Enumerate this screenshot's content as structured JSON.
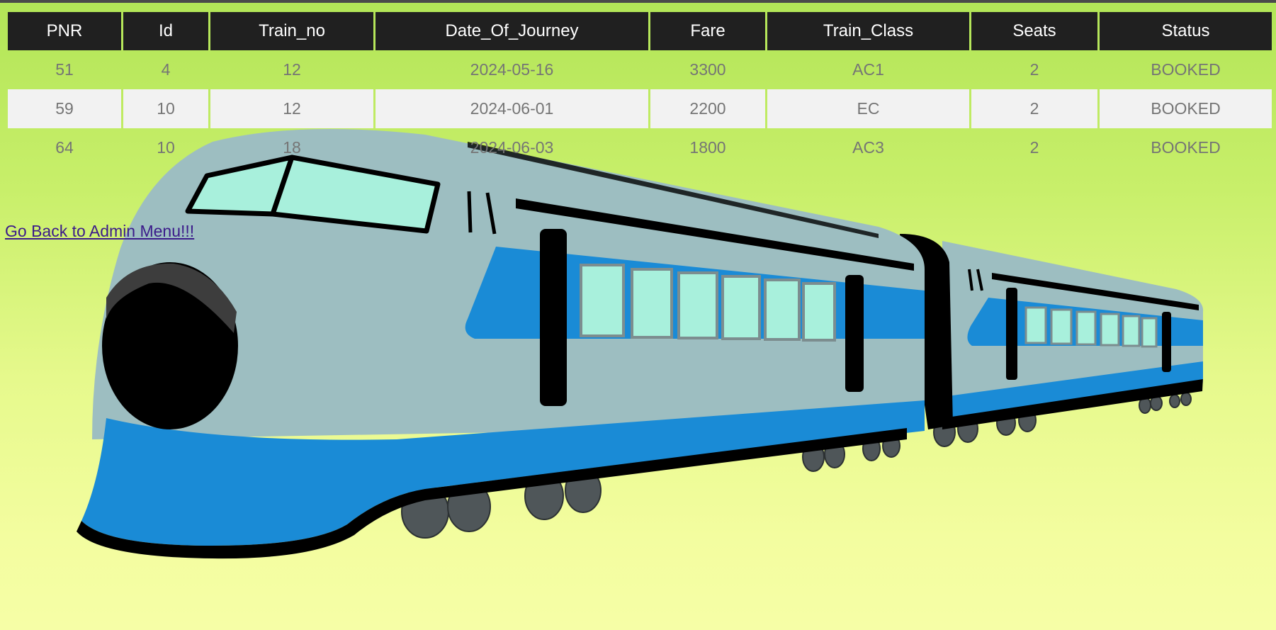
{
  "table": {
    "headers": [
      "PNR",
      "Id",
      "Train_no",
      "Date_Of_Journey",
      "Fare",
      "Train_Class",
      "Seats",
      "Status"
    ],
    "rows": [
      [
        "51",
        "4",
        "12",
        "2024-05-16",
        "3300",
        "AC1",
        "2",
        "BOOKED"
      ],
      [
        "59",
        "10",
        "12",
        "2024-06-01",
        "2200",
        "EC",
        "2",
        "BOOKED"
      ],
      [
        "64",
        "10",
        "18",
        "2024-06-03",
        "1800",
        "AC3",
        "2",
        "BOOKED"
      ]
    ]
  },
  "back_link": {
    "label": "Go Back to Admin Menu!!!"
  },
  "colors": {
    "header_bg": "#202020",
    "header_text": "#ffffff",
    "cell_text": "#757575",
    "alt_row_bg": "#f2f2f2",
    "link": "#3b1a8a",
    "train_body": "#9dbec1",
    "train_stripe": "#1a8bd6",
    "train_window": "#a8f0dc"
  },
  "background_image": "bullet-train-illustration"
}
